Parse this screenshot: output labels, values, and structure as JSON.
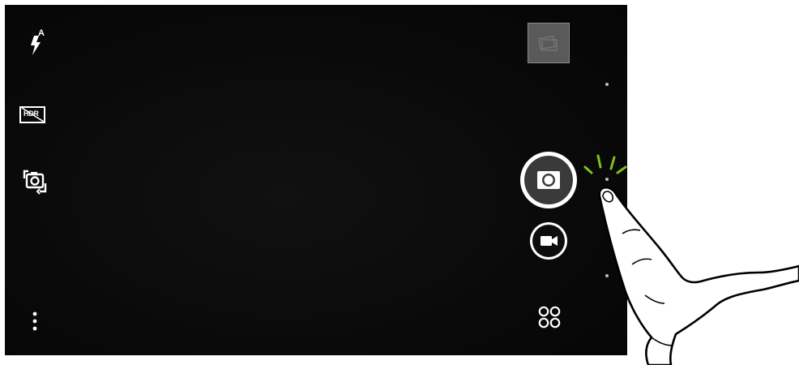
{
  "camera": {
    "left_controls": {
      "flash": {
        "icon": "flash-auto-icon",
        "badge": "A"
      },
      "hdr": {
        "icon": "hdr-off-icon",
        "label": "HDR"
      },
      "switch_camera": {
        "icon": "switch-camera-icon"
      },
      "menu": {
        "icon": "more-vertical-icon"
      }
    },
    "right_controls": {
      "gallery_thumbnail": {
        "icon": "gallery-thumbnail-icon"
      },
      "shutter": {
        "icon": "camera-shutter-icon"
      },
      "video": {
        "icon": "video-record-icon"
      },
      "modes": {
        "icon": "camera-modes-icon"
      }
    },
    "page_indicator_count": 3
  },
  "overlay": {
    "gesture": "tap",
    "hand_icon": "pointing-finger-icon",
    "tap_highlight_color": "#7dc21e"
  },
  "colors": {
    "screen_background": "#0a0a0a",
    "icon": "#ffffff",
    "shutter_inner": "#3a3a3a"
  }
}
